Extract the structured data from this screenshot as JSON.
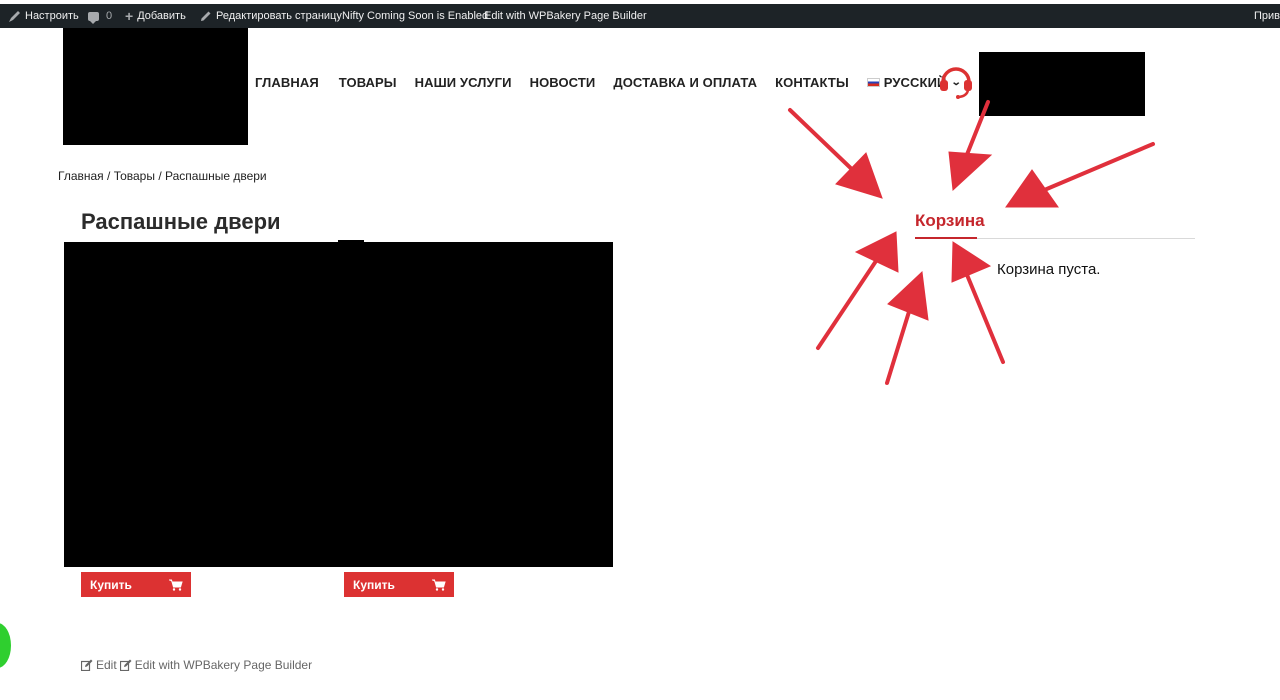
{
  "admin_bar": {
    "customize": "Настроить",
    "comments_count": "0",
    "add_new": "Добавить",
    "edit_page": "Редактировать страницу",
    "nifty": "Nifty Coming Soon is Enabled",
    "wpbakery": "Edit with WPBakery Page Builder",
    "greeting": "Приве"
  },
  "nav": {
    "items": [
      "ГЛАВНАЯ",
      "ТОВАРЫ",
      "НАШИ УСЛУГИ",
      "НОВОСТИ",
      "ДОСТАВКА И ОПЛАТА",
      "КОНТАКТЫ"
    ],
    "language": "РУССКИЙ"
  },
  "breadcrumb": {
    "home": "Главная",
    "sep": " / ",
    "products": "Товары",
    "current": "Распашные двери"
  },
  "page": {
    "title": "Распашные двери"
  },
  "products": {
    "buy_label": "Купить"
  },
  "cart": {
    "title": "Корзина",
    "empty_text": "Корзина пуста."
  },
  "footer": {
    "edit": "Edit",
    "edit_wpbakery": "Edit with WPBakery Page Builder"
  },
  "colors": {
    "accent_red": "#dc3232",
    "cart_title_red": "#c5262c",
    "annotation_arrow": "#e0303c",
    "admin_bar": "#1d2327",
    "badge_green": "#2fcf2f"
  },
  "icons": [
    "brush-icon",
    "comment-icon",
    "plus-icon",
    "pencil-icon",
    "headset-icon",
    "cart-icon",
    "edit-icon",
    "chevron-down-icon",
    "flag-ru-icon"
  ]
}
